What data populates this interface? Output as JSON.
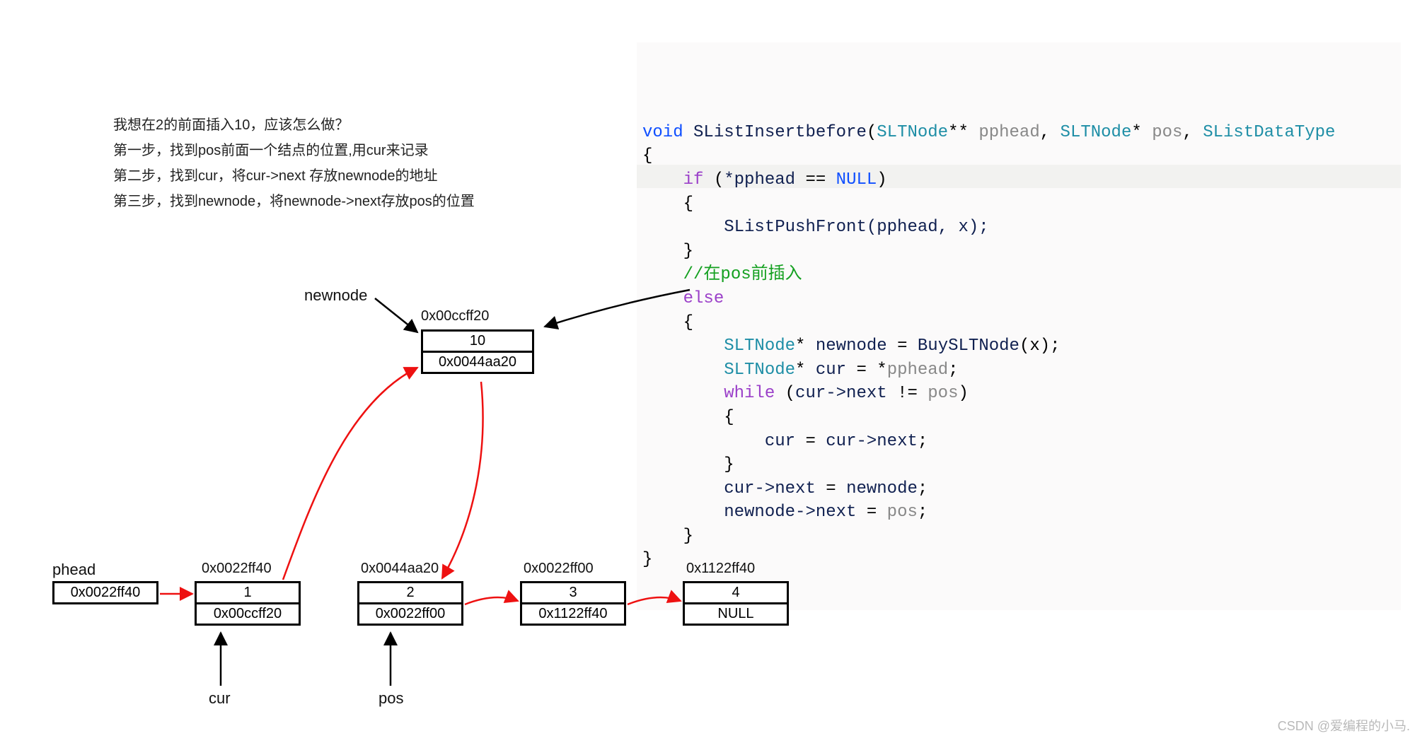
{
  "explain": {
    "q": "我想在2的前面插入10，应该怎么做？",
    "s1": "第一步，找到pos前面一个结点的位置,用cur来记录",
    "s2": "第二步，找到cur，将cur->next 存放newnode的地址",
    "s3": "第三步，找到newnode，将newnode->next存放pos的位置"
  },
  "code": {
    "t_void": "void",
    "fn": "SListInsertbefore",
    "t_star": "SLTNode",
    "pp": "pphead",
    "pos": "pos",
    "dt": "SListDataType",
    "lb": "{",
    "rb": "}",
    "t_if": "if",
    "cond": "*pphead == NULL",
    "call_pf": "SListPushFront(pphead, x);",
    "cmt": "//在pos前插入",
    "t_else": "else",
    "nn_decl": "SLTNode* newnode = BuySLTNode(x);",
    "cur_decl": "SLTNode* cur = *pphead;",
    "t_while": "while",
    "wcond": "cur->next != pos",
    "w_body": "cur = cur->next;",
    "a1": "cur->next = newnode;",
    "a2": "newnode->next = pos;"
  },
  "newnode": {
    "label": "newnode",
    "addr": "0x00ccff20",
    "data": "10",
    "next": "0x0044aa20"
  },
  "phead": {
    "label": "phead",
    "value": "0x0022ff40"
  },
  "n1": {
    "addr": "0x0022ff40",
    "data": "1",
    "next": "0x00ccff20"
  },
  "n2": {
    "addr": "0x0044aa20",
    "data": "2",
    "next": "0x0022ff00"
  },
  "n3": {
    "addr": "0x0022ff00",
    "data": "3",
    "next": "0x1122ff40"
  },
  "n4": {
    "addr": "0x1122ff40",
    "data": "4",
    "next": "NULL"
  },
  "cur_label": "cur",
  "pos_label": "pos",
  "watermark": "CSDN @爱编程的小马."
}
